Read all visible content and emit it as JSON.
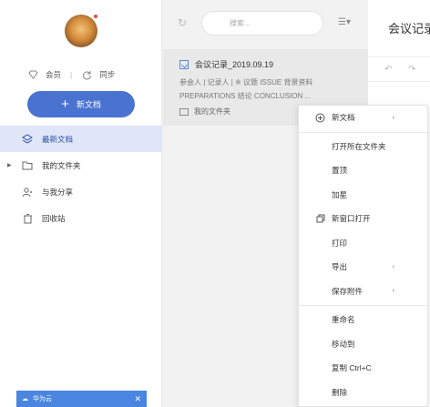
{
  "sidebar": {
    "member_label": "会员",
    "sync_label": "同步",
    "new_doc_label": "新文档",
    "nav": [
      {
        "label": "最新文档",
        "icon": "layers-icon",
        "active": true
      },
      {
        "label": "我的文件夹",
        "icon": "folder-icon",
        "expandable": true
      },
      {
        "label": "与我分享",
        "icon": "share-users-icon"
      },
      {
        "label": "回收站",
        "icon": "trash-icon"
      }
    ],
    "promo_label": "华为云"
  },
  "middle": {
    "search_placeholder": "搜索...",
    "doc": {
      "title": "会议记录_2019.09.19",
      "line1": "参会人 | 记录人 | ※ 议题 ISSUE 背景资料",
      "line2": "PREPARATIONS 结论 CONCLUSION ...",
      "folder": "我的文件夹"
    }
  },
  "editor": {
    "title": "会议记录"
  },
  "context_menu": {
    "items": [
      {
        "label": "新文档",
        "icon": "plus-circle-icon",
        "submenu": true
      },
      {
        "label": "打开所在文件夹"
      },
      {
        "label": "置顶"
      },
      {
        "label": "加星"
      },
      {
        "label": "新窗口打开",
        "icon": "window-icon"
      },
      {
        "label": "打印"
      },
      {
        "label": "导出",
        "submenu": true
      },
      {
        "label": "保存附件",
        "submenu": true
      },
      {
        "label": "重命名"
      },
      {
        "label": "移动到"
      },
      {
        "label": "复制 Ctrl+C"
      },
      {
        "label": "删除"
      }
    ]
  },
  "colors": {
    "accent": "#4a72d0",
    "active_nav_bg": "#dfe6f7",
    "promo_bg": "#4a86e0"
  }
}
